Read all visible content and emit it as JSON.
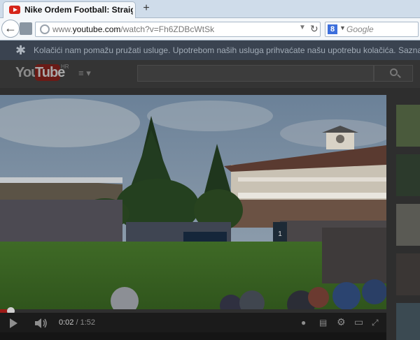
{
  "browser": {
    "tab_title": "Nike Ordem Football: Straight ...",
    "new_tab_label": "+",
    "url_prefix": "www.",
    "url_domain": "youtube.com",
    "url_path": "/watch?v=Fh6ZDBcWtSk",
    "search_engine_letter": "8",
    "search_placeholder": "Google"
  },
  "cookie_banner": {
    "text": "Kolačići nam pomažu pružati usluge. Upotrebom naših usluga prihvaćate našu upotrebu kolačića.   Saznajte v"
  },
  "masthead": {
    "logo_you": "You",
    "logo_tube": "Tube",
    "region": "HR",
    "guide_label": "≡ ▾"
  },
  "player": {
    "time_current": "0:02",
    "time_sep": " / ",
    "time_total": "1:52",
    "progress": 0.02,
    "billboard": "1"
  },
  "colors": {
    "accent": "#9c1b17",
    "chrome": "#cfdcea",
    "page_dim": "#2e2e2e"
  },
  "icons": [
    "back-arrow-icon",
    "identity-icon",
    "globe-icon",
    "reload-icon",
    "google-icon",
    "cookie-star-icon",
    "guide-menu-icon",
    "search-icon",
    "play-icon",
    "volume-icon",
    "annotations-icon",
    "captions-icon",
    "settings-gear-icon",
    "theater-icon",
    "fullscreen-icon"
  ]
}
